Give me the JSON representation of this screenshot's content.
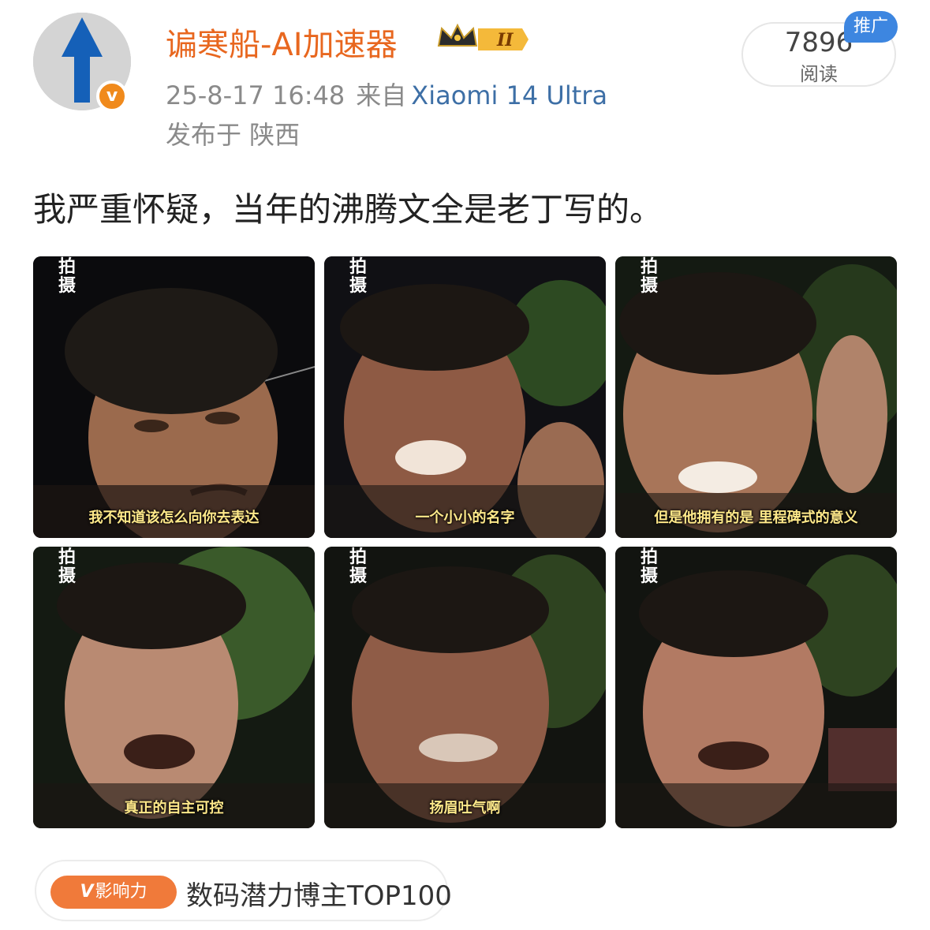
{
  "user": {
    "name": "谝寒船-AI加速器",
    "level_badge": "II",
    "timestamp": "25-8-17 16:48",
    "source_prefix": "来自",
    "device": "Xiaomi 14 Ultra",
    "location": "发布于 陕西"
  },
  "stats": {
    "views": "7896",
    "views_label": "阅读",
    "promo_tag": "推广"
  },
  "post": {
    "text": "我严重怀疑，当年的沸腾文全是老丁写的。"
  },
  "images": [
    {
      "corner": "拍摄",
      "caption": "我不知道该怎么向你去表达"
    },
    {
      "corner": "拍摄",
      "caption": "一个小小的名字"
    },
    {
      "corner": "拍摄",
      "caption": "但是他拥有的是 里程碑式的意义"
    },
    {
      "corner": "拍摄",
      "caption": "真正的自主可控"
    },
    {
      "corner": "拍摄",
      "caption": "扬眉吐气啊"
    },
    {
      "corner": "拍摄",
      "caption": ""
    }
  ],
  "influence": {
    "chip_v": "V",
    "chip_label": "影响力",
    "text": "数码潜力博主TOP100"
  },
  "colors": {
    "username": "#e8671f",
    "device_link": "#3d6fa6",
    "promo_bg": "#3d86e0",
    "influence_chip": "#f07a3a"
  }
}
